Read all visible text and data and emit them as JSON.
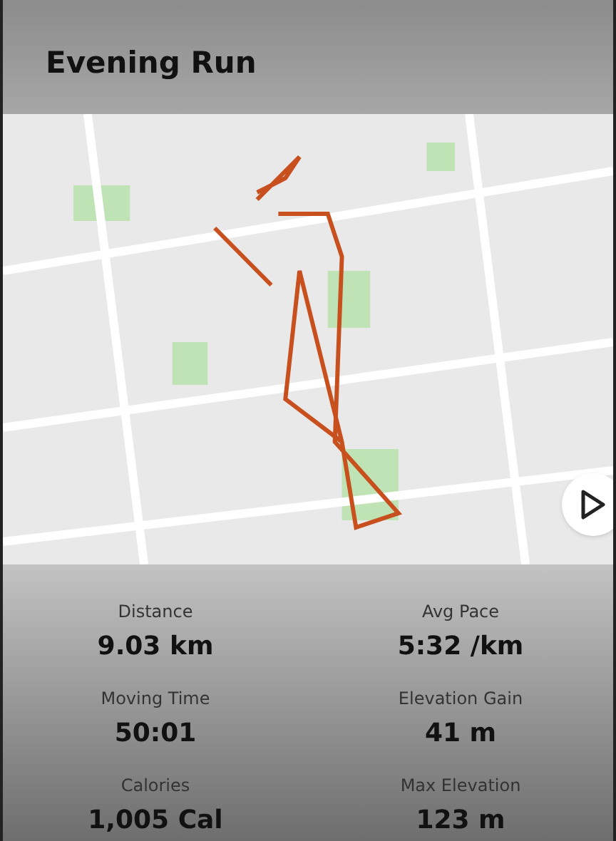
{
  "title": "Evening Run",
  "stats": [
    {
      "label": "Distance",
      "value": "9.03 km"
    },
    {
      "label": "Avg Pace",
      "value": "5:32 /km"
    },
    {
      "label": "Moving Time",
      "value": "50:01"
    },
    {
      "label": "Elevation Gain",
      "value": "41 m"
    },
    {
      "label": "Calories",
      "value": "1,005 Cal"
    },
    {
      "label": "Max Elevation",
      "value": "123 m"
    }
  ]
}
